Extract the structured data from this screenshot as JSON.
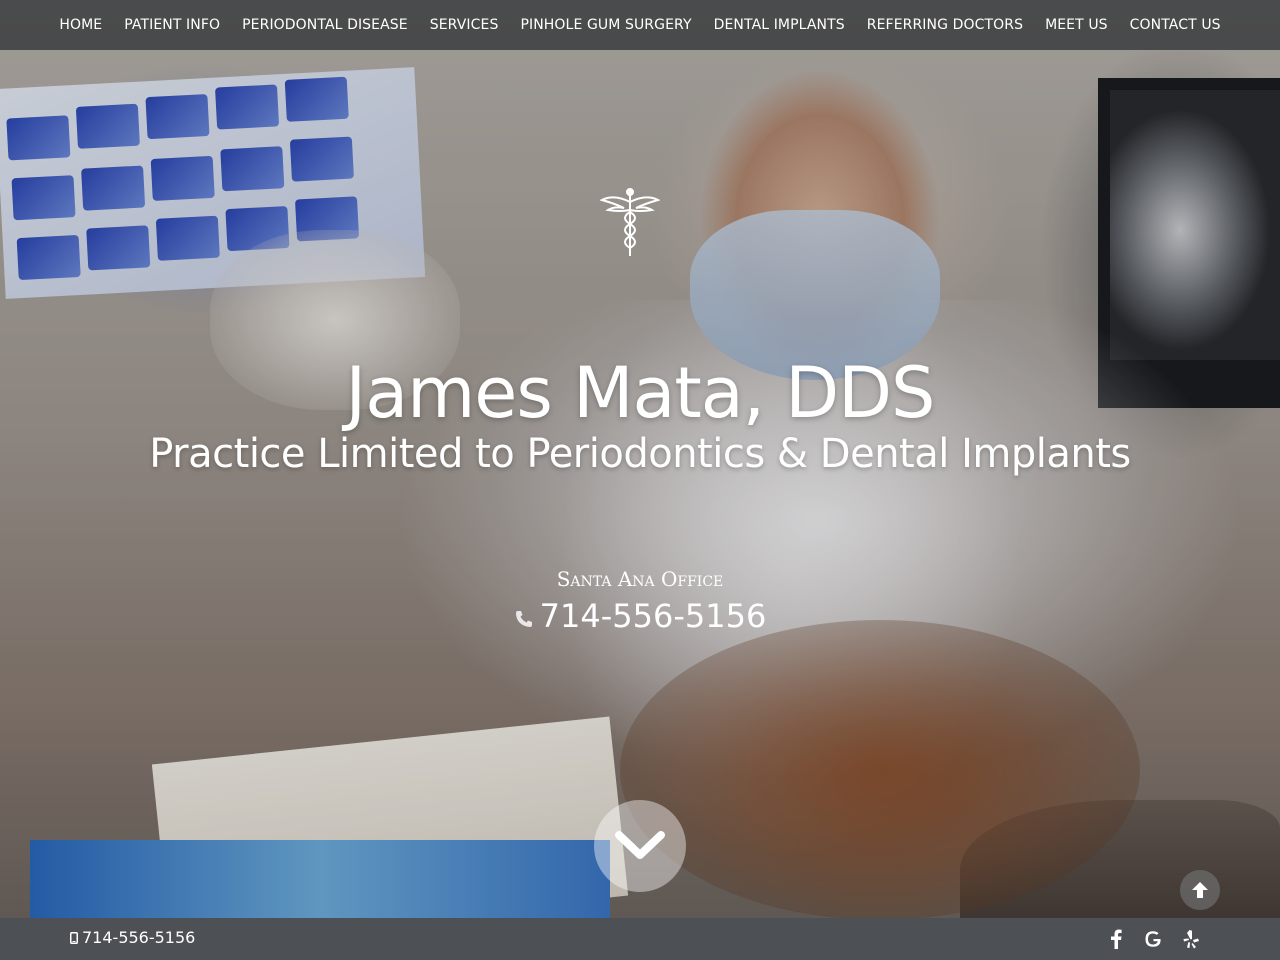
{
  "nav": {
    "items": [
      {
        "label": "HOME"
      },
      {
        "label": "PATIENT INFO"
      },
      {
        "label": "PERIODONTAL DISEASE"
      },
      {
        "label": "SERVICES"
      },
      {
        "label": "PINHOLE GUM SURGERY"
      },
      {
        "label": "DENTAL IMPLANTS"
      },
      {
        "label": "REFERRING DOCTORS"
      },
      {
        "label": "MEET US"
      },
      {
        "label": "CONTACT US"
      }
    ]
  },
  "hero": {
    "icon": "caduceus-icon",
    "title": "James Mata, DDS",
    "subtitle": "Practice Limited to Periodontics & Dental Implants",
    "office_label": "Santa Ana Office",
    "phone": "714-556-5156",
    "phone_icon": "phone-icon",
    "scroll_icon": "chevron-down-icon",
    "back_to_top_icon": "arrow-up-icon"
  },
  "footer": {
    "phone_icon": "mobile-phone-icon",
    "phone": "714-556-5156",
    "social": [
      {
        "icon": "facebook-icon"
      },
      {
        "icon": "google-icon"
      },
      {
        "icon": "yelp-icon"
      }
    ]
  },
  "colors": {
    "nav_bg": "#323437",
    "footer_bg": "#4d5054",
    "text": "#ffffff"
  }
}
